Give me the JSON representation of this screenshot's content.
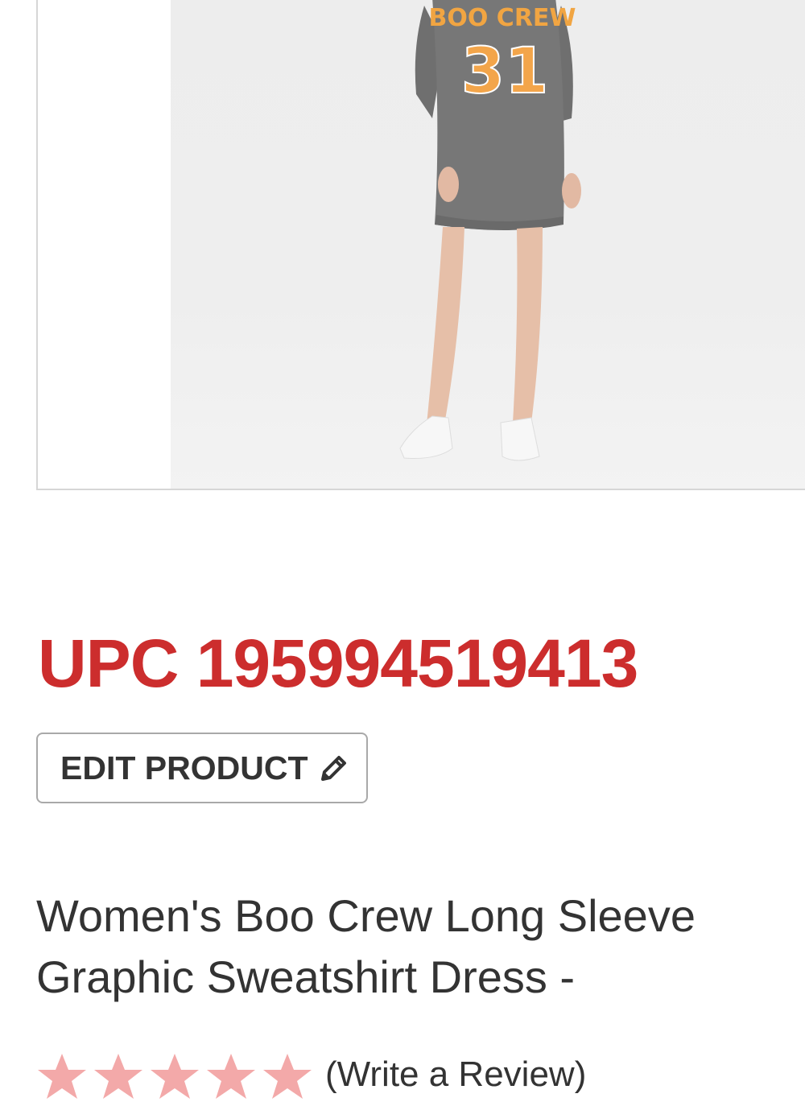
{
  "product": {
    "upc_text": "UPC 195994519413",
    "edit_button_label": "EDIT PRODUCT",
    "title": "Women's Boo Crew Long Sleeve Graphic Sweatshirt Dress -",
    "write_review_label": "(Write a Review)",
    "image_print_text": "BOO CREW",
    "image_print_number": "31",
    "rating_stars_total": 5
  },
  "colors": {
    "accent": "#cc2d2d",
    "text": "#333333",
    "star": "#f3a9a9"
  },
  "icons": {
    "edit": "pencil-icon",
    "rating": "star-icon"
  }
}
